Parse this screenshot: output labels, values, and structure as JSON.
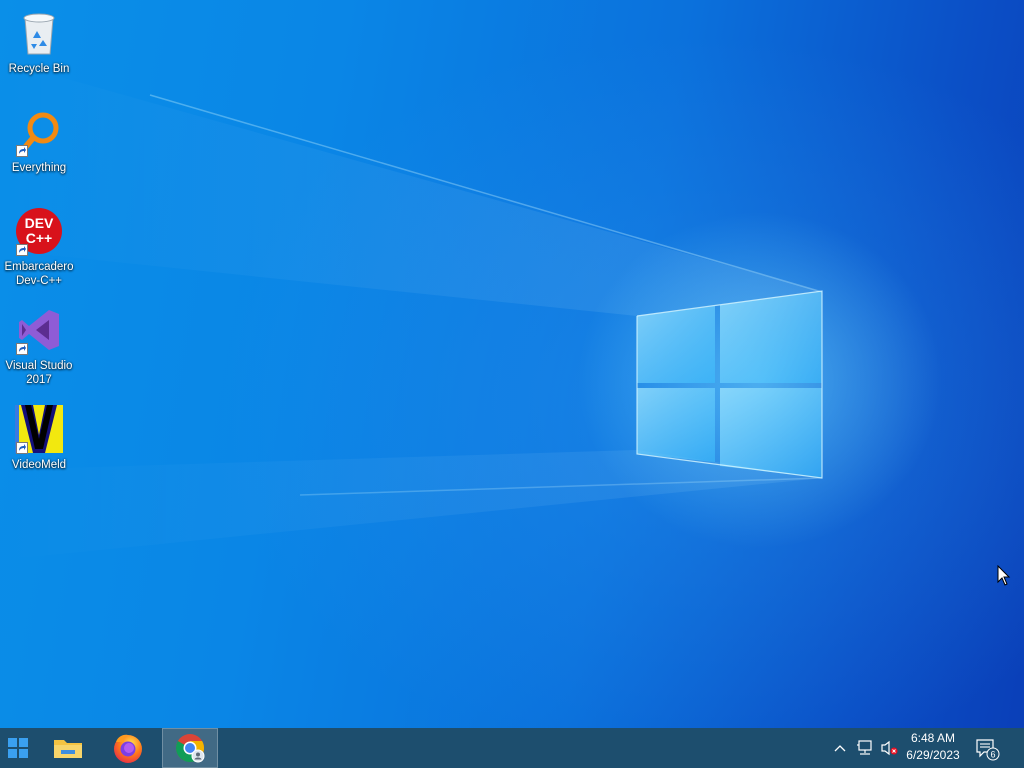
{
  "desktop": {
    "icons": [
      {
        "label": "Recycle Bin",
        "icon": "recycle-bin-icon",
        "shortcut": false
      },
      {
        "label": "Everything",
        "icon": "everything-search-icon",
        "shortcut": true
      },
      {
        "label": "Embarcadero Dev-C++",
        "icon": "dev-cpp-icon",
        "badge_text": "DEV\nC++",
        "shortcut": true
      },
      {
        "label": "Visual Studio 2017",
        "icon": "visual-studio-icon",
        "shortcut": true
      },
      {
        "label": "VideoMeld",
        "icon": "videomeld-icon",
        "shortcut": true
      }
    ],
    "wallpaper": "windows-logo-light-beam",
    "colors": {
      "wallpaper_light": "#0a8fe8",
      "wallpaper_dark": "#0a3fb8",
      "taskbar": "#1d4e6e"
    }
  },
  "taskbar": {
    "apps": [
      {
        "name": "start-button",
        "icon": "windows-logo-icon"
      },
      {
        "name": "file-explorer",
        "icon": "folder-icon"
      },
      {
        "name": "firefox",
        "icon": "firefox-icon"
      },
      {
        "name": "chrome",
        "icon": "chrome-icon",
        "active": true
      }
    ],
    "tray": {
      "overflow_icon": "chevron-up-icon",
      "network_icon": "network-icon",
      "volume_icon": "volume-muted-icon",
      "time": "6:48 AM",
      "date": "6/29/2023",
      "notification_count": "6"
    }
  }
}
